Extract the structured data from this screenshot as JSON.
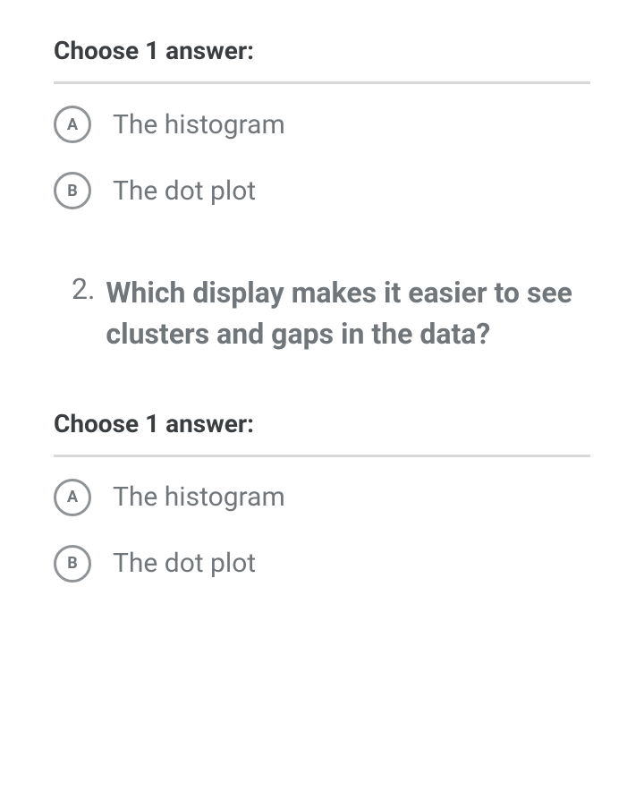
{
  "section1": {
    "prompt": "Choose 1 answer:",
    "options": [
      {
        "letter": "A",
        "label": "The histogram"
      },
      {
        "letter": "B",
        "label": "The dot plot"
      }
    ]
  },
  "question2": {
    "number": "2.",
    "text": "Which display makes it easier to see clusters and gaps in the data?"
  },
  "section2": {
    "prompt": "Choose 1 answer:",
    "options": [
      {
        "letter": "A",
        "label": "The histogram"
      },
      {
        "letter": "B",
        "label": "The dot plot"
      }
    ]
  }
}
